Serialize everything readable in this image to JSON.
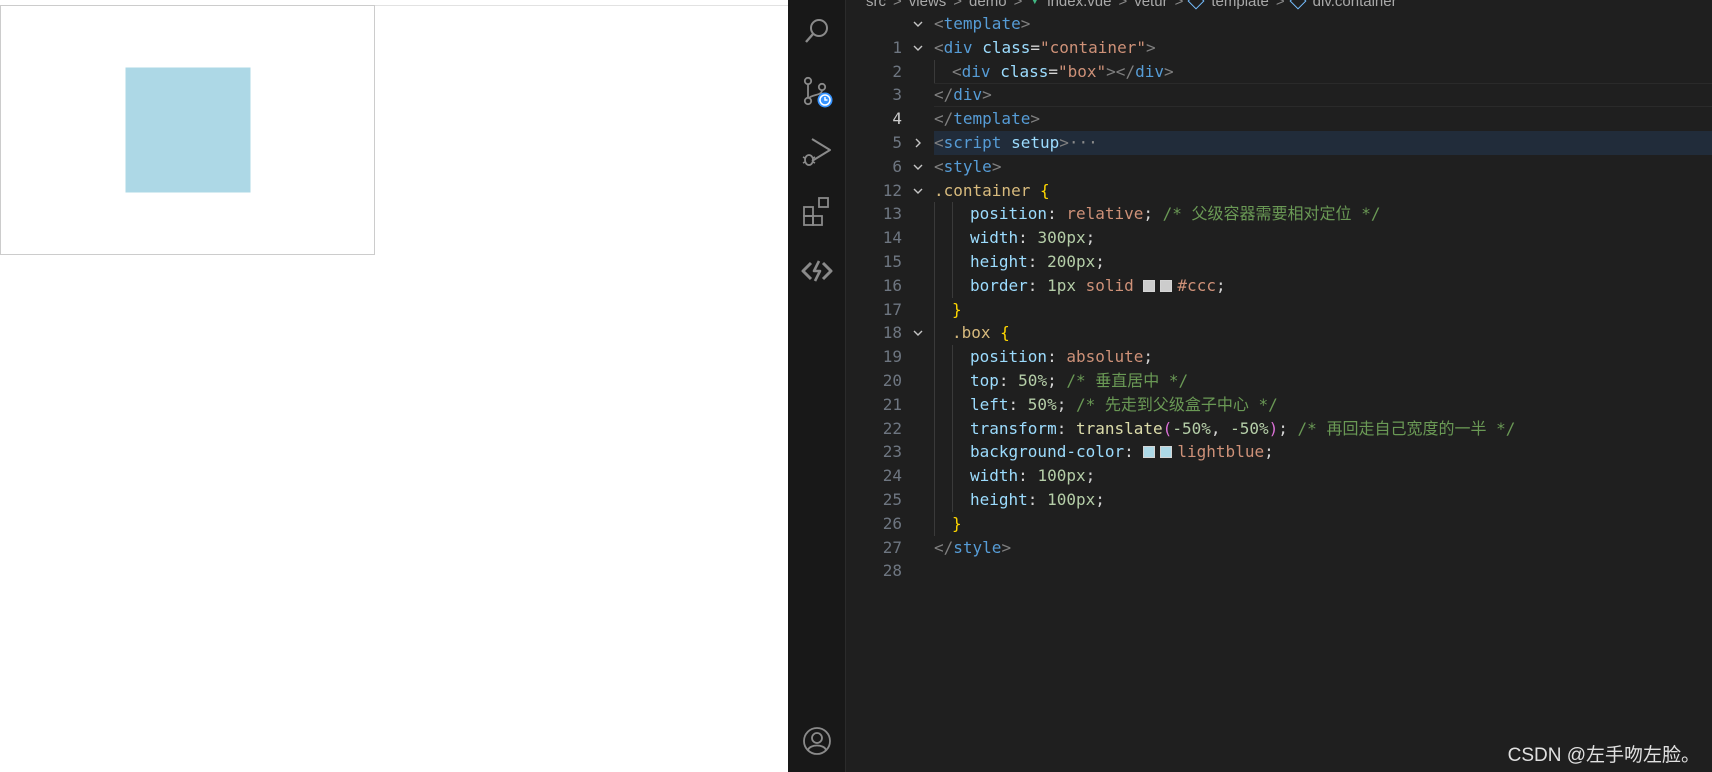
{
  "colors": {
    "box_fill": "#add8e6",
    "container_border": "#cccccc",
    "swatch_ccc": "#cccccc",
    "swatch_lightblue": "#add8e6"
  },
  "activity_bar": {
    "icons": [
      "search-icon",
      "source-control-icon",
      "run-debug-icon",
      "extensions-icon",
      "remote-icon",
      "account-icon"
    ]
  },
  "breadcrumbs": {
    "items": [
      "src",
      "views",
      "demo",
      "index.vue",
      "vetur",
      "template",
      "div.container"
    ],
    "separator": ">"
  },
  "code": {
    "l1": {
      "num": "1"
    },
    "l2": {
      "num": "2",
      "class_val": "\"container\""
    },
    "l3": {
      "num": "3",
      "class_val": "\"box\""
    },
    "l4": {
      "num": "4"
    },
    "l5": {
      "num": "5"
    },
    "l6": {
      "num": "6",
      "attr": "setup",
      "ellipsis": "···"
    },
    "l12": {
      "num": "12"
    },
    "l13": {
      "num": "13",
      "selector": ".container"
    },
    "l14": {
      "num": "14",
      "prop": "position",
      "value": "relative",
      "comment": "/* 父级容器需要相对定位 */"
    },
    "l15": {
      "num": "15",
      "prop": "width",
      "value": "300px"
    },
    "l16": {
      "num": "16",
      "prop": "height",
      "value": "200px"
    },
    "l17": {
      "num": "17",
      "prop": "border",
      "v1": "1px",
      "v2": "solid",
      "v3": "#ccc"
    },
    "l18": {
      "num": "18"
    },
    "l19": {
      "num": "19",
      "selector": ".box"
    },
    "l20": {
      "num": "20",
      "prop": "position",
      "value": "absolute"
    },
    "l21": {
      "num": "21",
      "prop": "top",
      "value": "50%",
      "comment": "/* 垂直居中 */"
    },
    "l22": {
      "num": "22",
      "prop": "left",
      "value": "50%",
      "comment": "/* 先走到父级盒子中心 */"
    },
    "l23": {
      "num": "23",
      "prop": "transform",
      "fn": "translate",
      "a1": "-50%",
      "a2": "-50%",
      "comment": "/* 再回走自己宽度的一半 */"
    },
    "l24": {
      "num": "24",
      "prop": "background-color",
      "value": "lightblue"
    },
    "l25": {
      "num": "25",
      "prop": "width",
      "value": "100px"
    },
    "l26": {
      "num": "26",
      "prop": "height",
      "value": "100px"
    },
    "l27": {
      "num": "27"
    },
    "l28": {
      "num": "28"
    }
  },
  "watermark": "CSDN @左手吻左脸。"
}
